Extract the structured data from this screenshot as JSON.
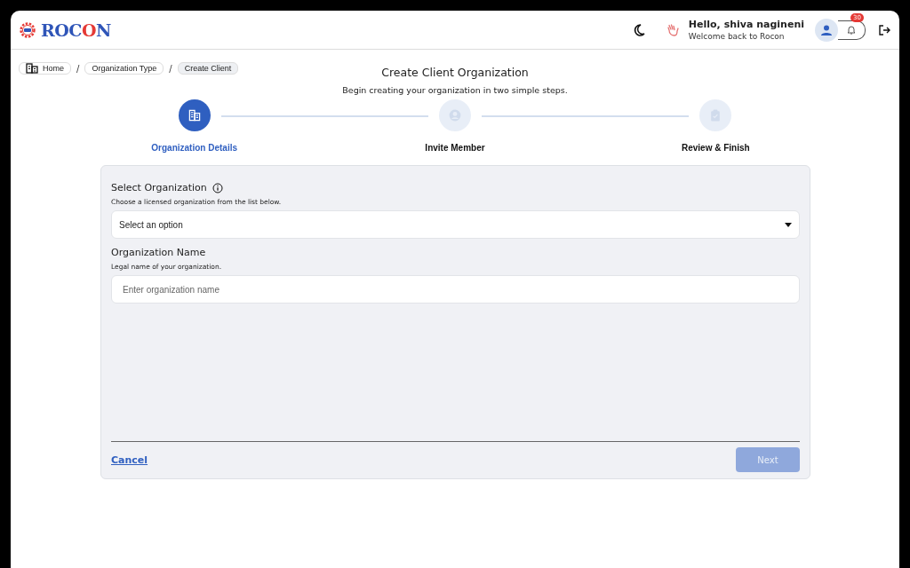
{
  "header": {
    "logo": {
      "start": "ROC",
      "accent": "O",
      "end": "N"
    },
    "greeting": "Hello, shiva nagineni",
    "subtitle": "Welcome back to Rocon",
    "notification_count": "30"
  },
  "breadcrumbs": [
    {
      "label": "Home",
      "selected": false
    },
    {
      "label": "Organization Type",
      "selected": false
    },
    {
      "label": "Create Client",
      "selected": true
    }
  ],
  "breadcrumb_separators": [
    "/",
    "/"
  ],
  "page": {
    "title": "Create Client Organization",
    "subtitle": "Begin creating your organization in two simple steps."
  },
  "steps": [
    {
      "label": "Organization Details",
      "kind": "building",
      "selected": true
    },
    {
      "label": "Invite Member",
      "kind": "person",
      "selected": false
    },
    {
      "label": "Review & Finish",
      "kind": "clipboard",
      "selected": false
    }
  ],
  "form": {
    "fields": [
      {
        "kind": "select",
        "label": "Select Organization",
        "info": true,
        "hint": "Choose a licensed organization from the list below.",
        "value": "Select an option"
      },
      {
        "kind": "text",
        "label": "Organization Name",
        "info": false,
        "hint": "Legal name of your organization.",
        "placeholder": "Enter organization name"
      }
    ],
    "cancel": "Cancel",
    "next": {
      "label": "Next",
      "disabled": true
    }
  }
}
